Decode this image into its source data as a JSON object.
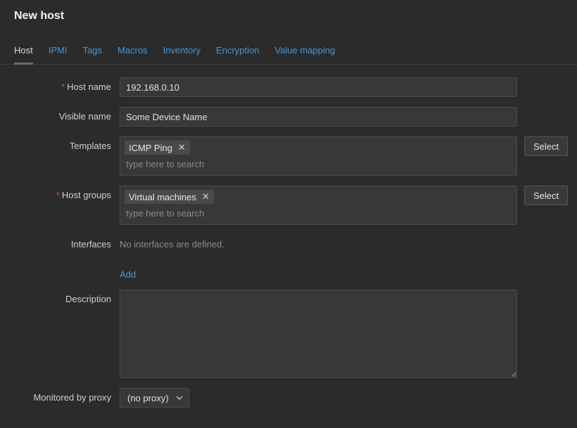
{
  "title": "New host",
  "tabs": [
    {
      "label": "Host"
    },
    {
      "label": "IPMI"
    },
    {
      "label": "Tags"
    },
    {
      "label": "Macros"
    },
    {
      "label": "Inventory"
    },
    {
      "label": "Encryption"
    },
    {
      "label": "Value mapping"
    }
  ],
  "labels": {
    "hostname": "Host name",
    "visiblename": "Visible name",
    "templates": "Templates",
    "hostgroups": "Host groups",
    "interfaces": "Interfaces",
    "description": "Description",
    "monitoredby": "Monitored by proxy"
  },
  "values": {
    "hostname": "192.168.0.10",
    "visiblename": "Some Device Name",
    "description": "",
    "monitoredby": "(no proxy)"
  },
  "templates": {
    "tags": [
      {
        "name": "ICMP Ping"
      }
    ],
    "placeholder": "type here to search",
    "select_label": "Select"
  },
  "hostgroups": {
    "tags": [
      {
        "name": "Virtual machines"
      }
    ],
    "placeholder": "type here to search",
    "select_label": "Select"
  },
  "interfaces": {
    "empty_text": "No interfaces are defined.",
    "add_label": "Add"
  }
}
